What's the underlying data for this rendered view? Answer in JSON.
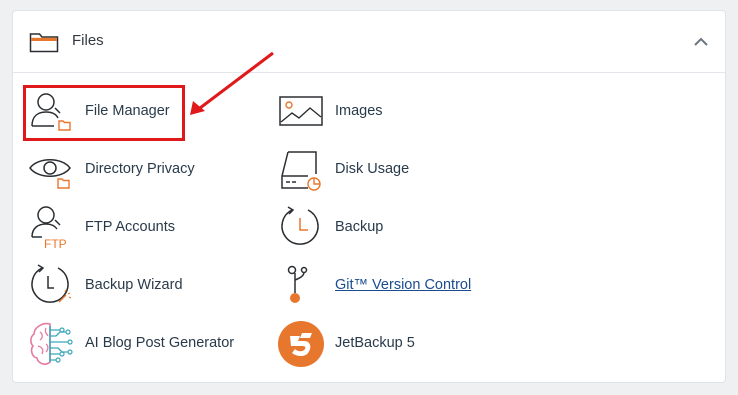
{
  "section": {
    "title": "Files",
    "icon": "folder-icon",
    "toggle_icon": "chevron-up-icon"
  },
  "items": [
    {
      "label": "File Manager",
      "icon": "file-manager-icon"
    },
    {
      "label": "Images",
      "icon": "images-icon"
    },
    {
      "label": "Directory Privacy",
      "icon": "directory-privacy-icon"
    },
    {
      "label": "Disk Usage",
      "icon": "disk-usage-icon"
    },
    {
      "label": "FTP Accounts",
      "icon": "ftp-accounts-icon",
      "icon_text": "FTP"
    },
    {
      "label": "Backup",
      "icon": "backup-icon"
    },
    {
      "label": "Backup Wizard",
      "icon": "backup-wizard-icon"
    },
    {
      "label": "Git™ Version Control",
      "icon": "git-icon"
    },
    {
      "label": "AI Blog Post Generator",
      "icon": "ai-brain-icon"
    },
    {
      "label": "JetBackup 5",
      "icon": "jetbackup-icon"
    }
  ],
  "colors": {
    "accent_orange": "#e8772e",
    "highlight_red": "#e0191b",
    "icon_dark": "#2b2f33",
    "label_blue": "#293a4a",
    "link_blue": "#1a4d8f",
    "ai_teal": "#3aa6b9",
    "ai_pink": "#e77aa2"
  }
}
